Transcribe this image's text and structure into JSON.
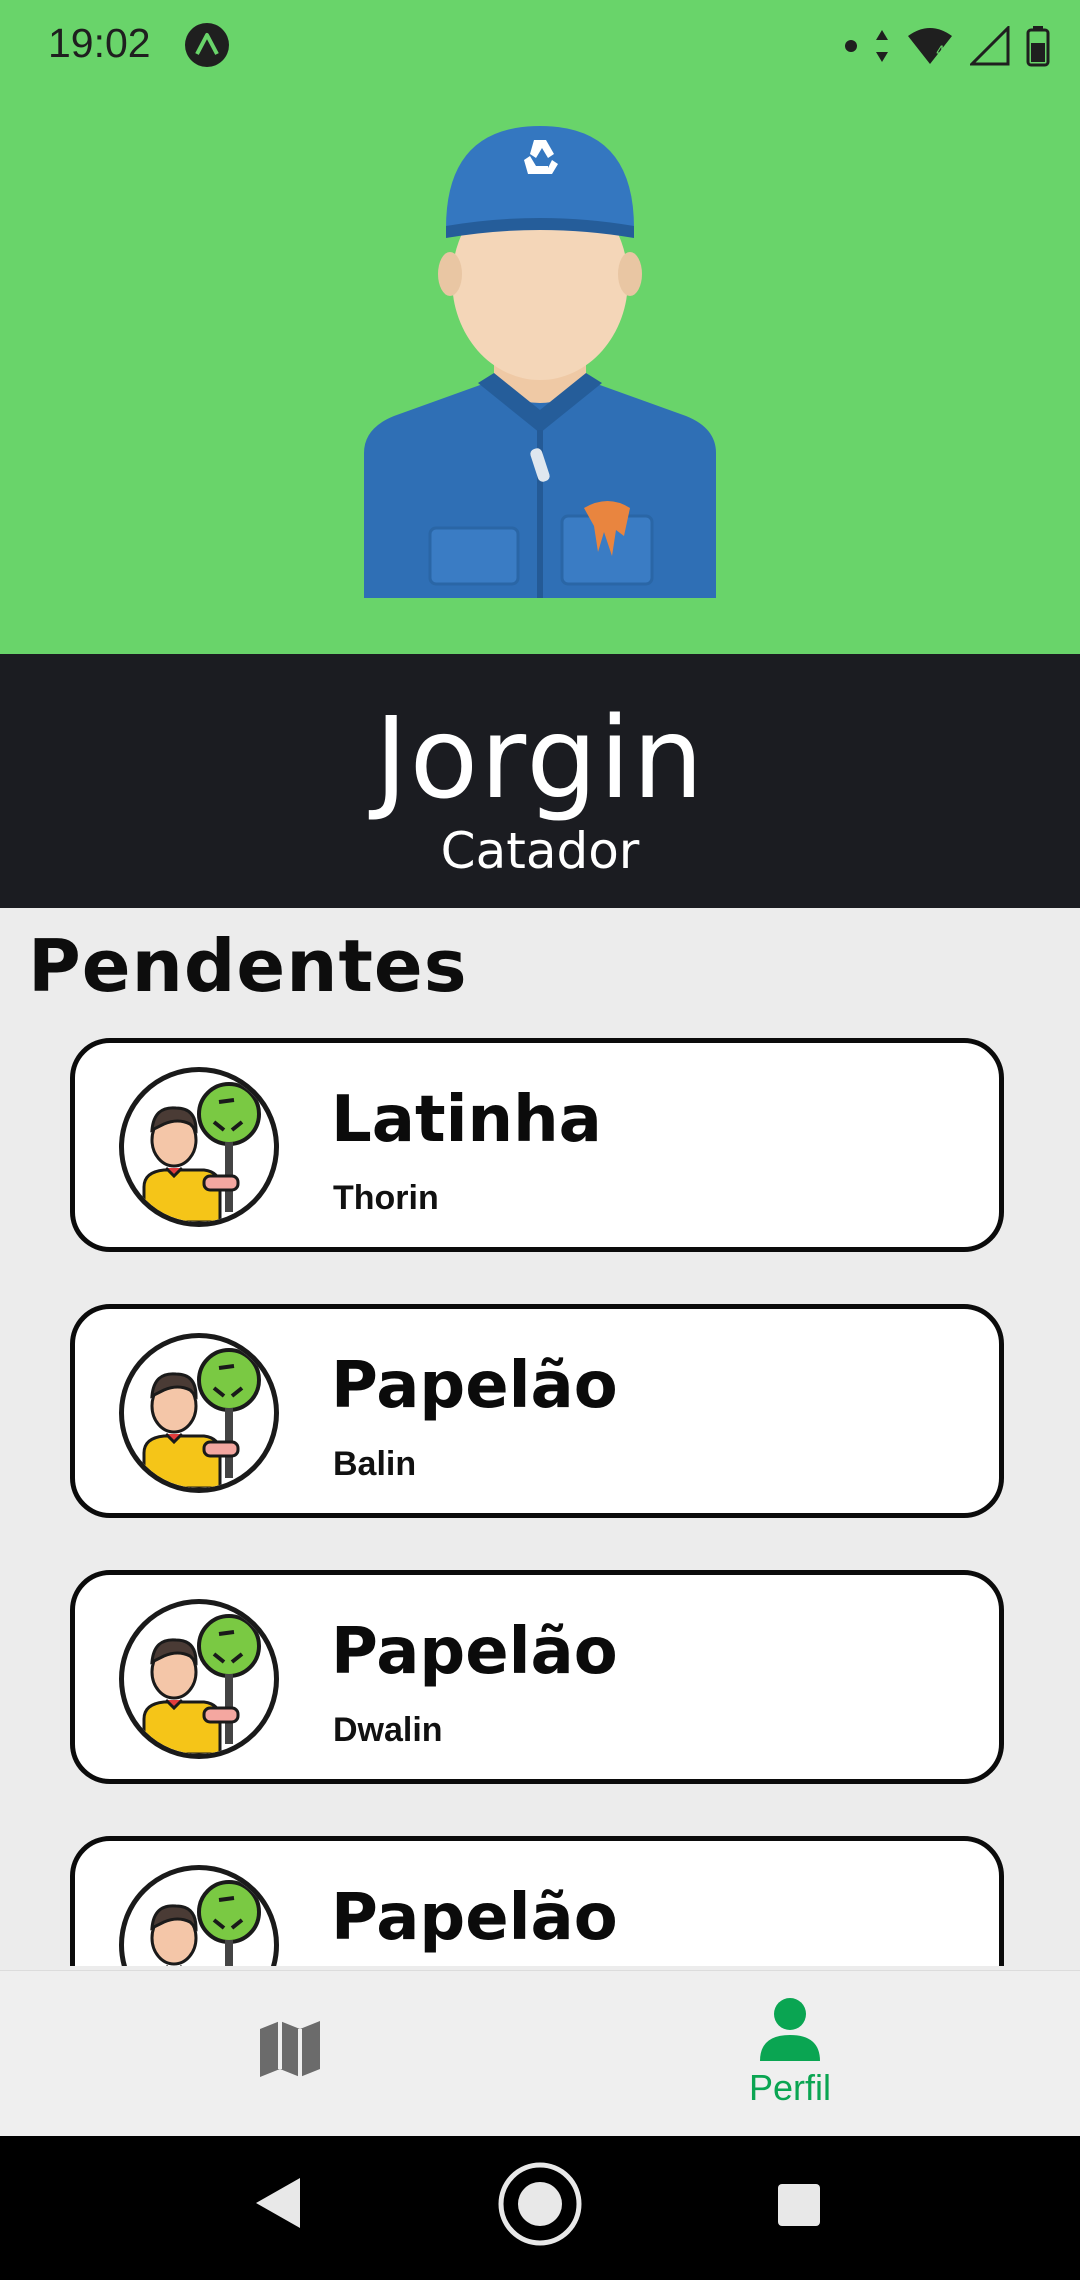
{
  "status_bar": {
    "time": "19:02",
    "app_icon": "a-logo-icon",
    "network_badge": "4"
  },
  "profile": {
    "name": "Jorgin",
    "role": "Catador",
    "avatar": "worker-with-recycle-cap"
  },
  "section": {
    "title": "Pendentes"
  },
  "pending": [
    {
      "title": "Latinha",
      "subtitle": "Thorin"
    },
    {
      "title": "Papelão",
      "subtitle": "Balin"
    },
    {
      "title": "Papelão",
      "subtitle": "Dwalin"
    },
    {
      "title": "Papelão",
      "subtitle": ""
    }
  ],
  "bottom_nav": {
    "items": [
      {
        "icon": "map-icon",
        "label": ""
      },
      {
        "icon": "person-icon",
        "label": "Perfil",
        "active": true
      }
    ],
    "active_color": "#0aa552"
  },
  "colors": {
    "header_green": "#69d46a",
    "name_band": "#1b1c21",
    "background": "#ececec"
  }
}
